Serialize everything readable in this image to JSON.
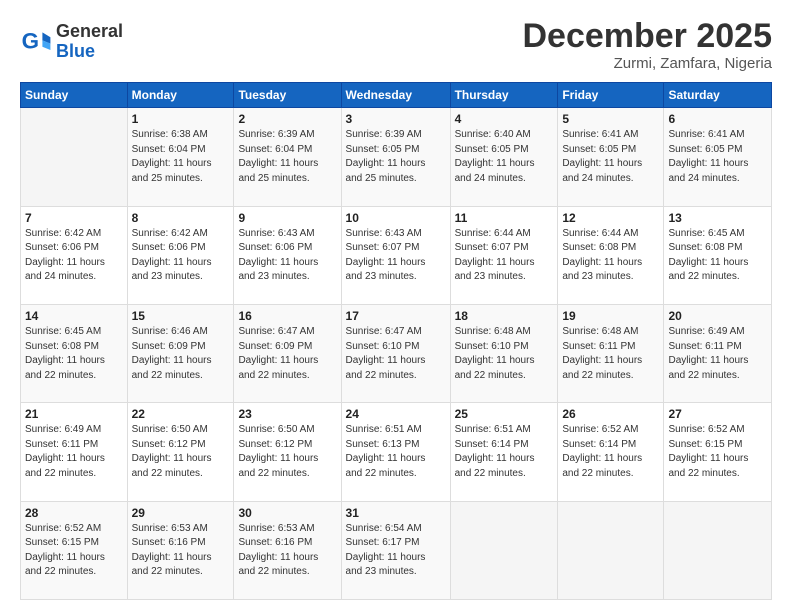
{
  "header": {
    "logo_general": "General",
    "logo_blue": "Blue",
    "month_title": "December 2025",
    "location": "Zurmi, Zamfara, Nigeria"
  },
  "calendar": {
    "days_of_week": [
      "Sunday",
      "Monday",
      "Tuesday",
      "Wednesday",
      "Thursday",
      "Friday",
      "Saturday"
    ],
    "weeks": [
      [
        {
          "num": "",
          "detail": ""
        },
        {
          "num": "1",
          "detail": "Sunrise: 6:38 AM\nSunset: 6:04 PM\nDaylight: 11 hours\nand 25 minutes."
        },
        {
          "num": "2",
          "detail": "Sunrise: 6:39 AM\nSunset: 6:04 PM\nDaylight: 11 hours\nand 25 minutes."
        },
        {
          "num": "3",
          "detail": "Sunrise: 6:39 AM\nSunset: 6:05 PM\nDaylight: 11 hours\nand 25 minutes."
        },
        {
          "num": "4",
          "detail": "Sunrise: 6:40 AM\nSunset: 6:05 PM\nDaylight: 11 hours\nand 24 minutes."
        },
        {
          "num": "5",
          "detail": "Sunrise: 6:41 AM\nSunset: 6:05 PM\nDaylight: 11 hours\nand 24 minutes."
        },
        {
          "num": "6",
          "detail": "Sunrise: 6:41 AM\nSunset: 6:05 PM\nDaylight: 11 hours\nand 24 minutes."
        }
      ],
      [
        {
          "num": "7",
          "detail": "Sunrise: 6:42 AM\nSunset: 6:06 PM\nDaylight: 11 hours\nand 24 minutes."
        },
        {
          "num": "8",
          "detail": "Sunrise: 6:42 AM\nSunset: 6:06 PM\nDaylight: 11 hours\nand 23 minutes."
        },
        {
          "num": "9",
          "detail": "Sunrise: 6:43 AM\nSunset: 6:06 PM\nDaylight: 11 hours\nand 23 minutes."
        },
        {
          "num": "10",
          "detail": "Sunrise: 6:43 AM\nSunset: 6:07 PM\nDaylight: 11 hours\nand 23 minutes."
        },
        {
          "num": "11",
          "detail": "Sunrise: 6:44 AM\nSunset: 6:07 PM\nDaylight: 11 hours\nand 23 minutes."
        },
        {
          "num": "12",
          "detail": "Sunrise: 6:44 AM\nSunset: 6:08 PM\nDaylight: 11 hours\nand 23 minutes."
        },
        {
          "num": "13",
          "detail": "Sunrise: 6:45 AM\nSunset: 6:08 PM\nDaylight: 11 hours\nand 22 minutes."
        }
      ],
      [
        {
          "num": "14",
          "detail": "Sunrise: 6:45 AM\nSunset: 6:08 PM\nDaylight: 11 hours\nand 22 minutes."
        },
        {
          "num": "15",
          "detail": "Sunrise: 6:46 AM\nSunset: 6:09 PM\nDaylight: 11 hours\nand 22 minutes."
        },
        {
          "num": "16",
          "detail": "Sunrise: 6:47 AM\nSunset: 6:09 PM\nDaylight: 11 hours\nand 22 minutes."
        },
        {
          "num": "17",
          "detail": "Sunrise: 6:47 AM\nSunset: 6:10 PM\nDaylight: 11 hours\nand 22 minutes."
        },
        {
          "num": "18",
          "detail": "Sunrise: 6:48 AM\nSunset: 6:10 PM\nDaylight: 11 hours\nand 22 minutes."
        },
        {
          "num": "19",
          "detail": "Sunrise: 6:48 AM\nSunset: 6:11 PM\nDaylight: 11 hours\nand 22 minutes."
        },
        {
          "num": "20",
          "detail": "Sunrise: 6:49 AM\nSunset: 6:11 PM\nDaylight: 11 hours\nand 22 minutes."
        }
      ],
      [
        {
          "num": "21",
          "detail": "Sunrise: 6:49 AM\nSunset: 6:11 PM\nDaylight: 11 hours\nand 22 minutes."
        },
        {
          "num": "22",
          "detail": "Sunrise: 6:50 AM\nSunset: 6:12 PM\nDaylight: 11 hours\nand 22 minutes."
        },
        {
          "num": "23",
          "detail": "Sunrise: 6:50 AM\nSunset: 6:12 PM\nDaylight: 11 hours\nand 22 minutes."
        },
        {
          "num": "24",
          "detail": "Sunrise: 6:51 AM\nSunset: 6:13 PM\nDaylight: 11 hours\nand 22 minutes."
        },
        {
          "num": "25",
          "detail": "Sunrise: 6:51 AM\nSunset: 6:14 PM\nDaylight: 11 hours\nand 22 minutes."
        },
        {
          "num": "26",
          "detail": "Sunrise: 6:52 AM\nSunset: 6:14 PM\nDaylight: 11 hours\nand 22 minutes."
        },
        {
          "num": "27",
          "detail": "Sunrise: 6:52 AM\nSunset: 6:15 PM\nDaylight: 11 hours\nand 22 minutes."
        }
      ],
      [
        {
          "num": "28",
          "detail": "Sunrise: 6:52 AM\nSunset: 6:15 PM\nDaylight: 11 hours\nand 22 minutes."
        },
        {
          "num": "29",
          "detail": "Sunrise: 6:53 AM\nSunset: 6:16 PM\nDaylight: 11 hours\nand 22 minutes."
        },
        {
          "num": "30",
          "detail": "Sunrise: 6:53 AM\nSunset: 6:16 PM\nDaylight: 11 hours\nand 22 minutes."
        },
        {
          "num": "31",
          "detail": "Sunrise: 6:54 AM\nSunset: 6:17 PM\nDaylight: 11 hours\nand 23 minutes."
        },
        {
          "num": "",
          "detail": ""
        },
        {
          "num": "",
          "detail": ""
        },
        {
          "num": "",
          "detail": ""
        }
      ]
    ]
  }
}
